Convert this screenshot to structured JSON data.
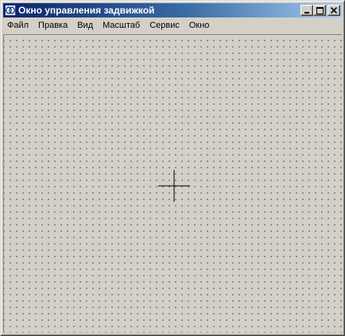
{
  "window": {
    "title": "Окно управления задвижкой",
    "app_icon": "app-logo-icon",
    "buttons": {
      "minimize": "minimize-icon",
      "maximize": "maximize-icon",
      "close": "close-icon"
    }
  },
  "menu": {
    "items": [
      {
        "label": "Файл"
      },
      {
        "label": "Правка"
      },
      {
        "label": "Вид"
      },
      {
        "label": "Масштаб"
      },
      {
        "label": "Сервис"
      },
      {
        "label": "Окно"
      }
    ]
  },
  "canvas": {
    "grid": true,
    "cursor": "crosshair-icon"
  },
  "colors": {
    "titlebar_start": "#0a246a",
    "titlebar_end": "#a6caf0",
    "face": "#d4d0c8",
    "grid_dot": "#3a3a3a"
  }
}
